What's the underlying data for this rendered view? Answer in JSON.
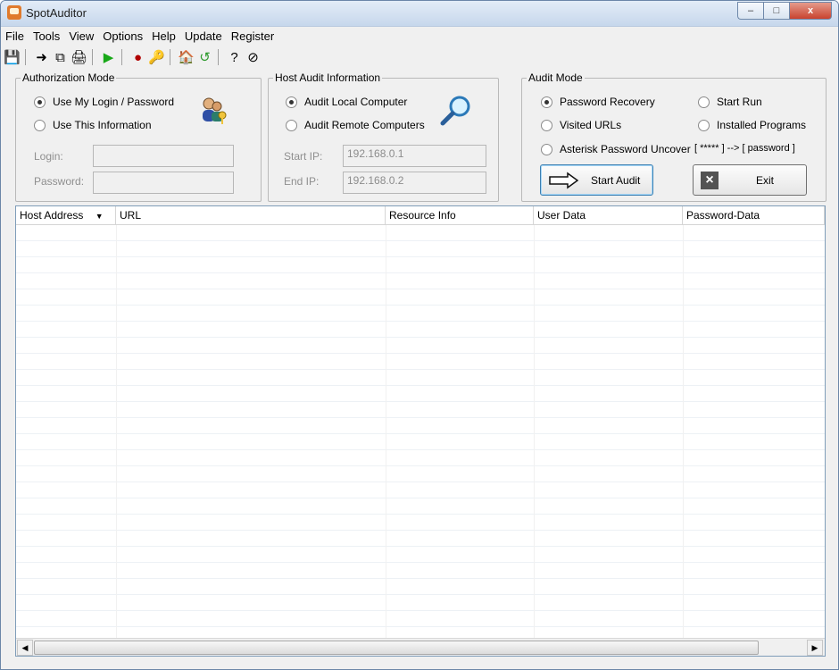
{
  "window": {
    "title": "SpotAuditor",
    "minimize": "–",
    "maximize": "□",
    "close": "x"
  },
  "menu": [
    "File",
    "Tools",
    "View",
    "Options",
    "Help",
    "Update",
    "Register"
  ],
  "toolbar_icons": [
    "save-icon",
    "export-icon",
    "copy-icon",
    "print-icon",
    "play-icon",
    "record-icon",
    "key-icon",
    "home-icon",
    "refresh-icon",
    "help-icon",
    "register-icon"
  ],
  "auth": {
    "title": "Authorization Mode",
    "use_login": "Use My Login / Password",
    "use_this": "Use This Information",
    "login_label": "Login:",
    "password_label": "Password:",
    "login_value": "",
    "password_value": ""
  },
  "host": {
    "title": "Host Audit Information",
    "local": "Audit Local Computer",
    "remote": "Audit Remote Computers",
    "start_label": "Start IP:",
    "end_label": "End IP:",
    "start_ip": "192.168.0.1",
    "end_ip": "192.168.0.2"
  },
  "audit": {
    "title": "Audit Mode",
    "password_recovery": "Password Recovery",
    "start_run": "Start Run",
    "visited_urls": "Visited URLs",
    "installed_programs": "Installed Programs",
    "asterisk": "Asterisk Password Uncover",
    "asterisk_hint": "[ ***** ] --> [ password ]",
    "start_button": "Start Audit",
    "exit_button": "Exit"
  },
  "table": {
    "columns": [
      "Host Address",
      "URL",
      "Resource Info",
      "User Data",
      "Password-Data"
    ],
    "sort_glyph": "▼"
  }
}
